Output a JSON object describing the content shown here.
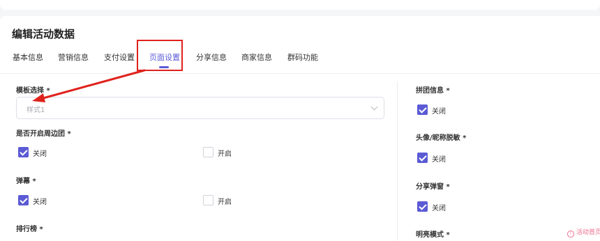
{
  "page": {
    "title": "编辑活动数据"
  },
  "tabs": [
    {
      "label": "基本信息"
    },
    {
      "label": "营销信息"
    },
    {
      "label": "支付设置"
    },
    {
      "label": "页面设置",
      "active": true
    },
    {
      "label": "分享信息"
    },
    {
      "label": "商家信息"
    },
    {
      "label": "群码功能"
    }
  ],
  "left": {
    "template": {
      "label": "模板选择 *",
      "value": "样式1"
    },
    "nearby_group": {
      "label": "是否开启周边团 *",
      "off_label": "关闭",
      "on_label": "开启",
      "selected": "关闭"
    },
    "barrage": {
      "label": "弹幕 *",
      "off_label": "关闭",
      "on_label": "开启",
      "selected": "关闭"
    },
    "ranking": {
      "label": "排行榜 *"
    }
  },
  "right": {
    "group_info": {
      "label": "拼团信息 *",
      "option": "关闭"
    },
    "avatar_mask": {
      "label": "头像/昵称脱敏 *",
      "option": "关闭"
    },
    "share_popup": {
      "label": "分享弹窗 *",
      "option": "关闭"
    },
    "highlight_mode": {
      "label": "明亮模式 *"
    }
  },
  "footer": {
    "link": "活动首页"
  },
  "colors": {
    "accent": "#5b5bd6",
    "annotation": "#e0221c",
    "link": "#ef6b8a"
  }
}
